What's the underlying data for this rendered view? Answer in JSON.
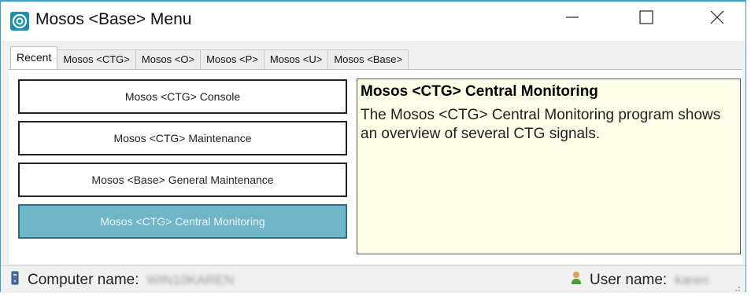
{
  "window": {
    "title": "Mosos <Base> Menu",
    "controls": {
      "minimize_icon": "minimize-icon",
      "maximize_icon": "maximize-icon",
      "close_icon": "close-icon"
    },
    "accent_color": "#3a9fc9"
  },
  "tabs": [
    {
      "label": "Recent",
      "active": true
    },
    {
      "label": "Mosos <CTG>",
      "active": false
    },
    {
      "label": "Mosos <O>",
      "active": false
    },
    {
      "label": "Mosos <P>",
      "active": false
    },
    {
      "label": "Mosos <U>",
      "active": false
    },
    {
      "label": "Mosos <Base>",
      "active": false
    }
  ],
  "menu_items": [
    {
      "label": "Mosos <CTG> Console",
      "selected": false
    },
    {
      "label": "Mosos <CTG> Maintenance",
      "selected": false
    },
    {
      "label": "Mosos <Base> General Maintenance",
      "selected": false
    },
    {
      "label": "Mosos <CTG> Central Monitoring",
      "selected": true
    }
  ],
  "description": {
    "title": "Mosos <CTG> Central Monitoring",
    "body": "The Mosos <CTG> Central Monitoring program shows an overview of several CTG signals.",
    "background_color": "#fefde8"
  },
  "statusbar": {
    "computer_label": "Computer name:",
    "computer_value": "WIN10KAREN",
    "user_label": "User name:",
    "user_value": "karen",
    "computer_icon": "computer-icon",
    "user_icon": "user-icon"
  },
  "colors": {
    "selected_item": "#71b5c9"
  }
}
